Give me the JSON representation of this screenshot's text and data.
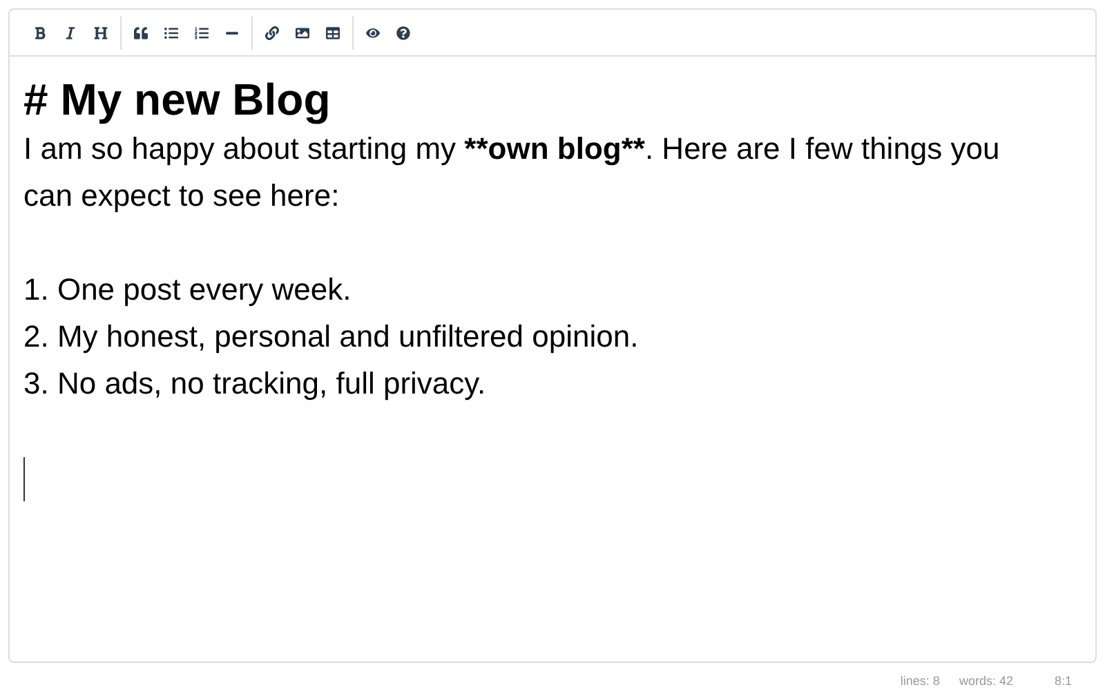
{
  "toolbar": [
    [
      {
        "kind": "bold"
      },
      {
        "kind": "italic"
      },
      {
        "kind": "heading"
      }
    ],
    [
      {
        "kind": "quote"
      },
      {
        "kind": "bullet-list"
      },
      {
        "kind": "numbered-list"
      },
      {
        "kind": "rule"
      }
    ],
    [
      {
        "kind": "link"
      },
      {
        "kind": "image"
      },
      {
        "kind": "table"
      }
    ],
    [
      {
        "kind": "preview"
      },
      {
        "kind": "help"
      }
    ]
  ],
  "editor": {
    "lines": [
      {
        "kind": "heading",
        "segments": [
          {
            "text": "# My new Blog"
          }
        ]
      },
      {
        "kind": "text",
        "segments": [
          {
            "text": "I am so happy about starting my ",
            "bold": false
          },
          {
            "text": "**own blog**",
            "bold": true
          },
          {
            "text": ". Here are I few things you can expect to see here:",
            "bold": false
          }
        ]
      },
      {
        "kind": "blank"
      },
      {
        "kind": "text",
        "segments": [
          {
            "text": "1. One post every week.",
            "bold": false
          }
        ]
      },
      {
        "kind": "text",
        "segments": [
          {
            "text": "2. My honest, personal and unfiltered opinion.",
            "bold": false
          }
        ]
      },
      {
        "kind": "text",
        "segments": [
          {
            "text": "3. No ads, no tracking, full privacy.",
            "bold": false
          }
        ]
      },
      {
        "kind": "blank"
      },
      {
        "kind": "cursor"
      }
    ]
  },
  "status_bar": {
    "lines": "lines: 8",
    "words": "words: 42",
    "position": "8:1"
  }
}
